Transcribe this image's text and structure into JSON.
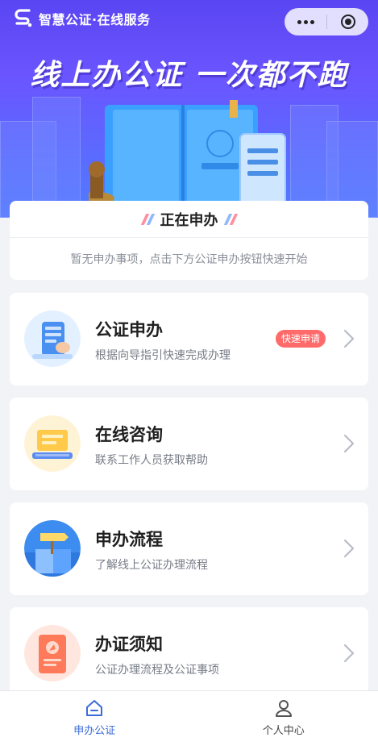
{
  "header": {
    "brand": "智慧公证·在线服务",
    "slogan": "线上办公证 一次都不跑"
  },
  "status": {
    "title": "正在申办",
    "empty_text": "暂无申办事项，点击下方公证申办按钮快速开始"
  },
  "services": [
    {
      "title": "公证申办",
      "subtitle": "根据向导指引快速完成办理",
      "badge": "快速申请",
      "icon": "phone-document-icon"
    },
    {
      "title": "在线咨询",
      "subtitle": "联系工作人员获取帮助",
      "icon": "laptop-chat-icon"
    },
    {
      "title": "申办流程",
      "subtitle": "了解线上公证办理流程",
      "icon": "signpost-icon"
    },
    {
      "title": "办证须知",
      "subtitle": "公证办理流程及公证事项",
      "icon": "compass-document-icon"
    }
  ],
  "tabbar": {
    "items": [
      {
        "label": "申办公证",
        "icon": "home-icon",
        "active": true
      },
      {
        "label": "个人中心",
        "icon": "user-icon",
        "active": false
      }
    ]
  },
  "colors": {
    "accent": "#3a6bd9",
    "badge": "#ff6b6b",
    "hero_top": "#5a45f2",
    "hero_bottom": "#4f7cff"
  }
}
